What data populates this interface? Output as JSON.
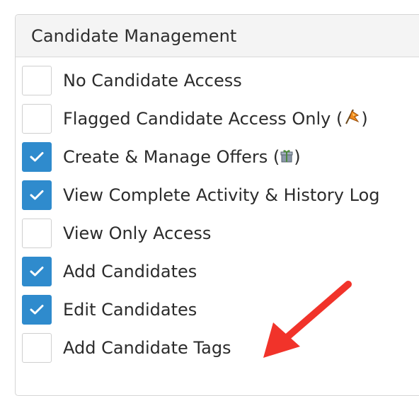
{
  "panel": {
    "title": "Candidate Management"
  },
  "options": [
    {
      "label": "No Candidate Access",
      "checked": false
    },
    {
      "label_prefix": "Flagged Candidate Access Only (",
      "label_suffix": ")",
      "icon": "flag-icon",
      "checked": false
    },
    {
      "label_prefix": "Create & Manage Offers (",
      "label_suffix": ")",
      "icon": "gift-icon",
      "checked": true
    },
    {
      "label": "View Complete Activity & History Log",
      "checked": true
    },
    {
      "label": "View Only Access",
      "checked": false
    },
    {
      "label": "Add Candidates",
      "checked": true
    },
    {
      "label": "Edit Candidates",
      "checked": true
    },
    {
      "label": "Add Candidate Tags",
      "checked": false
    }
  ],
  "annotation": {
    "icon": "red-arrow-icon",
    "color": "#f1332a"
  },
  "colors": {
    "checked": "#2f8bcd",
    "unchecked_border": "#cfcfcf",
    "header_bg": "#f4f4f4"
  }
}
